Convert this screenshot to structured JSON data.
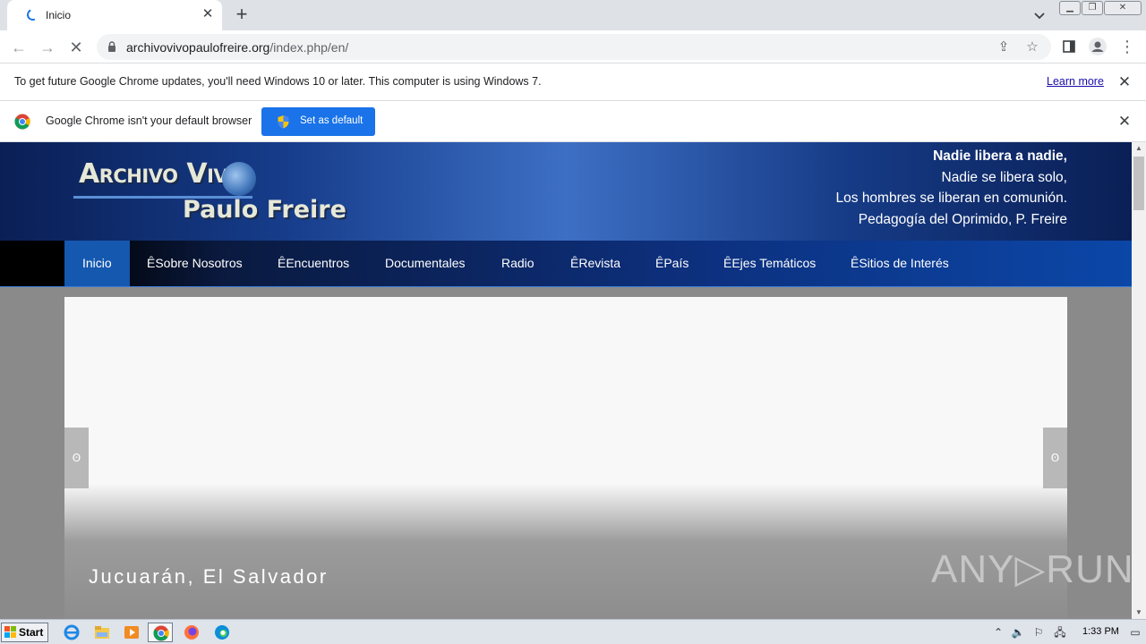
{
  "browser": {
    "tab_title": "Inicio",
    "url_host": "archivovivopaulofreire.org",
    "url_path": "/index.php/en/",
    "update_message": "To get future Google Chrome updates, you'll need Windows 10 or later. This computer is using Windows 7.",
    "learn_more": "Learn more",
    "default_message": "Google Chrome isn't your default browser",
    "set_default": "Set as default"
  },
  "site": {
    "logo_top": "Archivo Vivo",
    "logo_bottom": "Paulo Freire",
    "quote": {
      "line1": "Nadie libera a nadie,",
      "line2": "Nadie se libera solo,",
      "line3": "Los hombres se liberan en comunión.",
      "line4": "Pedagogía del Oprimido,  P. Freire"
    },
    "nav": [
      "Inicio",
      "ȆSobre Nosotros",
      "ȆEncuentros",
      "Documentales",
      "Radio",
      "ȆRevista",
      "ȆPaís",
      "ȆEjes Temáticos",
      "ȆSitios de Interés"
    ],
    "slider": {
      "caption": "Jucuarán, El Salvador",
      "arrow_left": "Ꙩ",
      "arrow_right": "Ꙩ"
    }
  },
  "watermark": "ANY▷RUN",
  "taskbar": {
    "start": "Start",
    "clock": "1:33 PM"
  },
  "colors": {
    "chrome_blue": "#1a73e8",
    "header_blue": "#163c8a",
    "nav_active": "#1558b0"
  }
}
